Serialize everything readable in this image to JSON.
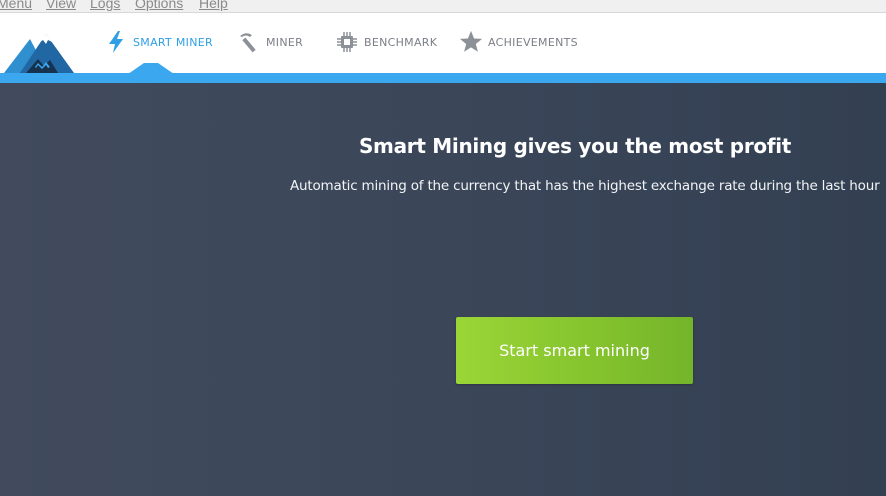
{
  "menubar": {
    "items": [
      "Menu",
      "View",
      "Logs",
      "Options",
      "Help"
    ]
  },
  "nav": {
    "tabs": [
      {
        "label": "SMART MINER",
        "icon": "lightning-icon",
        "active": true
      },
      {
        "label": "MINER",
        "icon": "pickaxe-icon",
        "active": false
      },
      {
        "label": "BENCHMARK",
        "icon": "chip-icon",
        "active": false
      },
      {
        "label": "ACHIEVEMENTS",
        "icon": "star-icon",
        "active": false
      }
    ]
  },
  "main": {
    "headline": "Smart Mining gives you the most profit",
    "subline": "Automatic mining of the currency that has the highest exchange rate during the last hour",
    "start_button": "Start smart mining"
  },
  "colors": {
    "accent": "#3aa7ee",
    "active_tab": "#2f9fe6",
    "inactive_tab": "#7b7f86",
    "background": "#3b4659",
    "button": "#86c42e"
  }
}
